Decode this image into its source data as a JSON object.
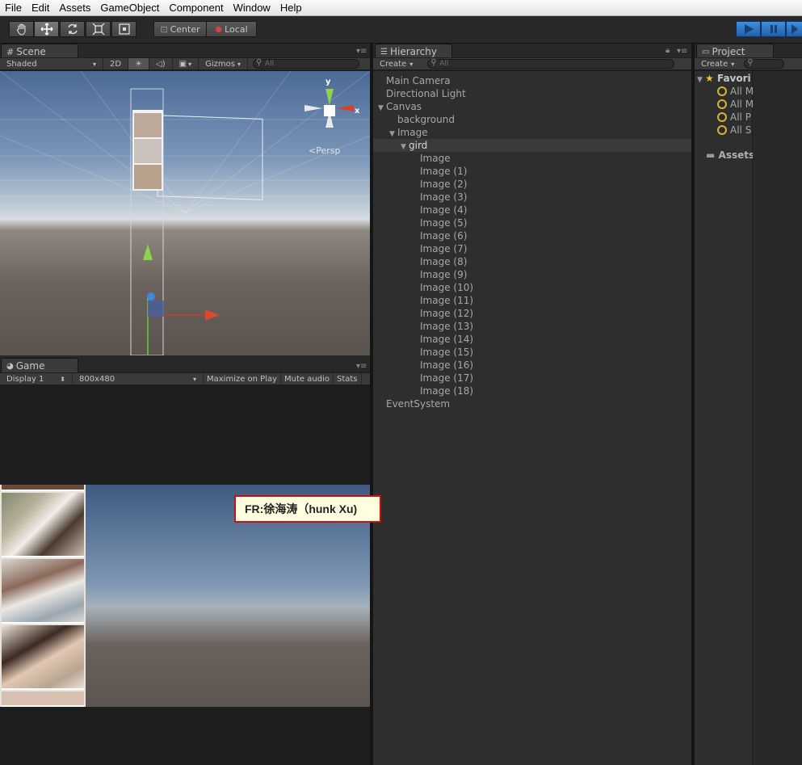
{
  "menu": [
    "File",
    "Edit",
    "Assets",
    "GameObject",
    "Component",
    "Window",
    "Help"
  ],
  "toolbar": {
    "tools": [
      "hand-icon",
      "move-icon",
      "rotate-icon",
      "scale-icon",
      "rect-icon"
    ],
    "pivot_label": "Center",
    "space_label": "Local"
  },
  "scene": {
    "tab_label": "Scene",
    "shading": "Shaded",
    "mode_2d": "2D",
    "gizmos_label": "Gizmos",
    "search_placeholder": "All",
    "persp_label": "Persp",
    "axis_y": "y",
    "axis_x": "x"
  },
  "game": {
    "tab_label": "Game",
    "display": "Display 1",
    "resolution": "800x480",
    "maximize": "Maximize on Play",
    "mute": "Mute audio",
    "stats": "Stats"
  },
  "hierarchy": {
    "tab_label": "Hierarchy",
    "create_label": "Create",
    "search_placeholder": "All",
    "items": [
      {
        "label": "Main Camera",
        "depth": 0,
        "arrow": ""
      },
      {
        "label": "Directional Light",
        "depth": 0,
        "arrow": ""
      },
      {
        "label": "Canvas",
        "depth": 0,
        "arrow": "▼"
      },
      {
        "label": "background",
        "depth": 1,
        "arrow": ""
      },
      {
        "label": "Image",
        "depth": 1,
        "arrow": "▼"
      },
      {
        "label": "gird",
        "depth": 2,
        "arrow": "▼",
        "selected": true
      },
      {
        "label": "Image",
        "depth": 3,
        "arrow": ""
      },
      {
        "label": "Image (1)",
        "depth": 3,
        "arrow": ""
      },
      {
        "label": "Image (2)",
        "depth": 3,
        "arrow": ""
      },
      {
        "label": "Image (3)",
        "depth": 3,
        "arrow": ""
      },
      {
        "label": "Image (4)",
        "depth": 3,
        "arrow": ""
      },
      {
        "label": "Image (5)",
        "depth": 3,
        "arrow": ""
      },
      {
        "label": "Image (6)",
        "depth": 3,
        "arrow": ""
      },
      {
        "label": "Image (7)",
        "depth": 3,
        "arrow": ""
      },
      {
        "label": "Image (8)",
        "depth": 3,
        "arrow": ""
      },
      {
        "label": "Image (9)",
        "depth": 3,
        "arrow": ""
      },
      {
        "label": "Image (10)",
        "depth": 3,
        "arrow": ""
      },
      {
        "label": "Image (11)",
        "depth": 3,
        "arrow": ""
      },
      {
        "label": "Image (12)",
        "depth": 3,
        "arrow": ""
      },
      {
        "label": "Image (13)",
        "depth": 3,
        "arrow": ""
      },
      {
        "label": "Image (14)",
        "depth": 3,
        "arrow": ""
      },
      {
        "label": "Image (15)",
        "depth": 3,
        "arrow": ""
      },
      {
        "label": "Image (16)",
        "depth": 3,
        "arrow": ""
      },
      {
        "label": "Image (17)",
        "depth": 3,
        "arrow": ""
      },
      {
        "label": "Image (18)",
        "depth": 3,
        "arrow": ""
      },
      {
        "label": "EventSystem",
        "depth": 0,
        "arrow": ""
      }
    ]
  },
  "project": {
    "tab_label": "Project",
    "create_label": "Create",
    "favorites_label": "Favori",
    "favorites": [
      "All M",
      "All M",
      "All P",
      "All S"
    ],
    "assets_label": "Assets"
  },
  "tooltip": "FR:徐海涛（hunk Xu)",
  "colors": {
    "accent_blue": "#2f78c8",
    "selection": "#3a3a3a",
    "tooltip_border": "#c81010"
  }
}
